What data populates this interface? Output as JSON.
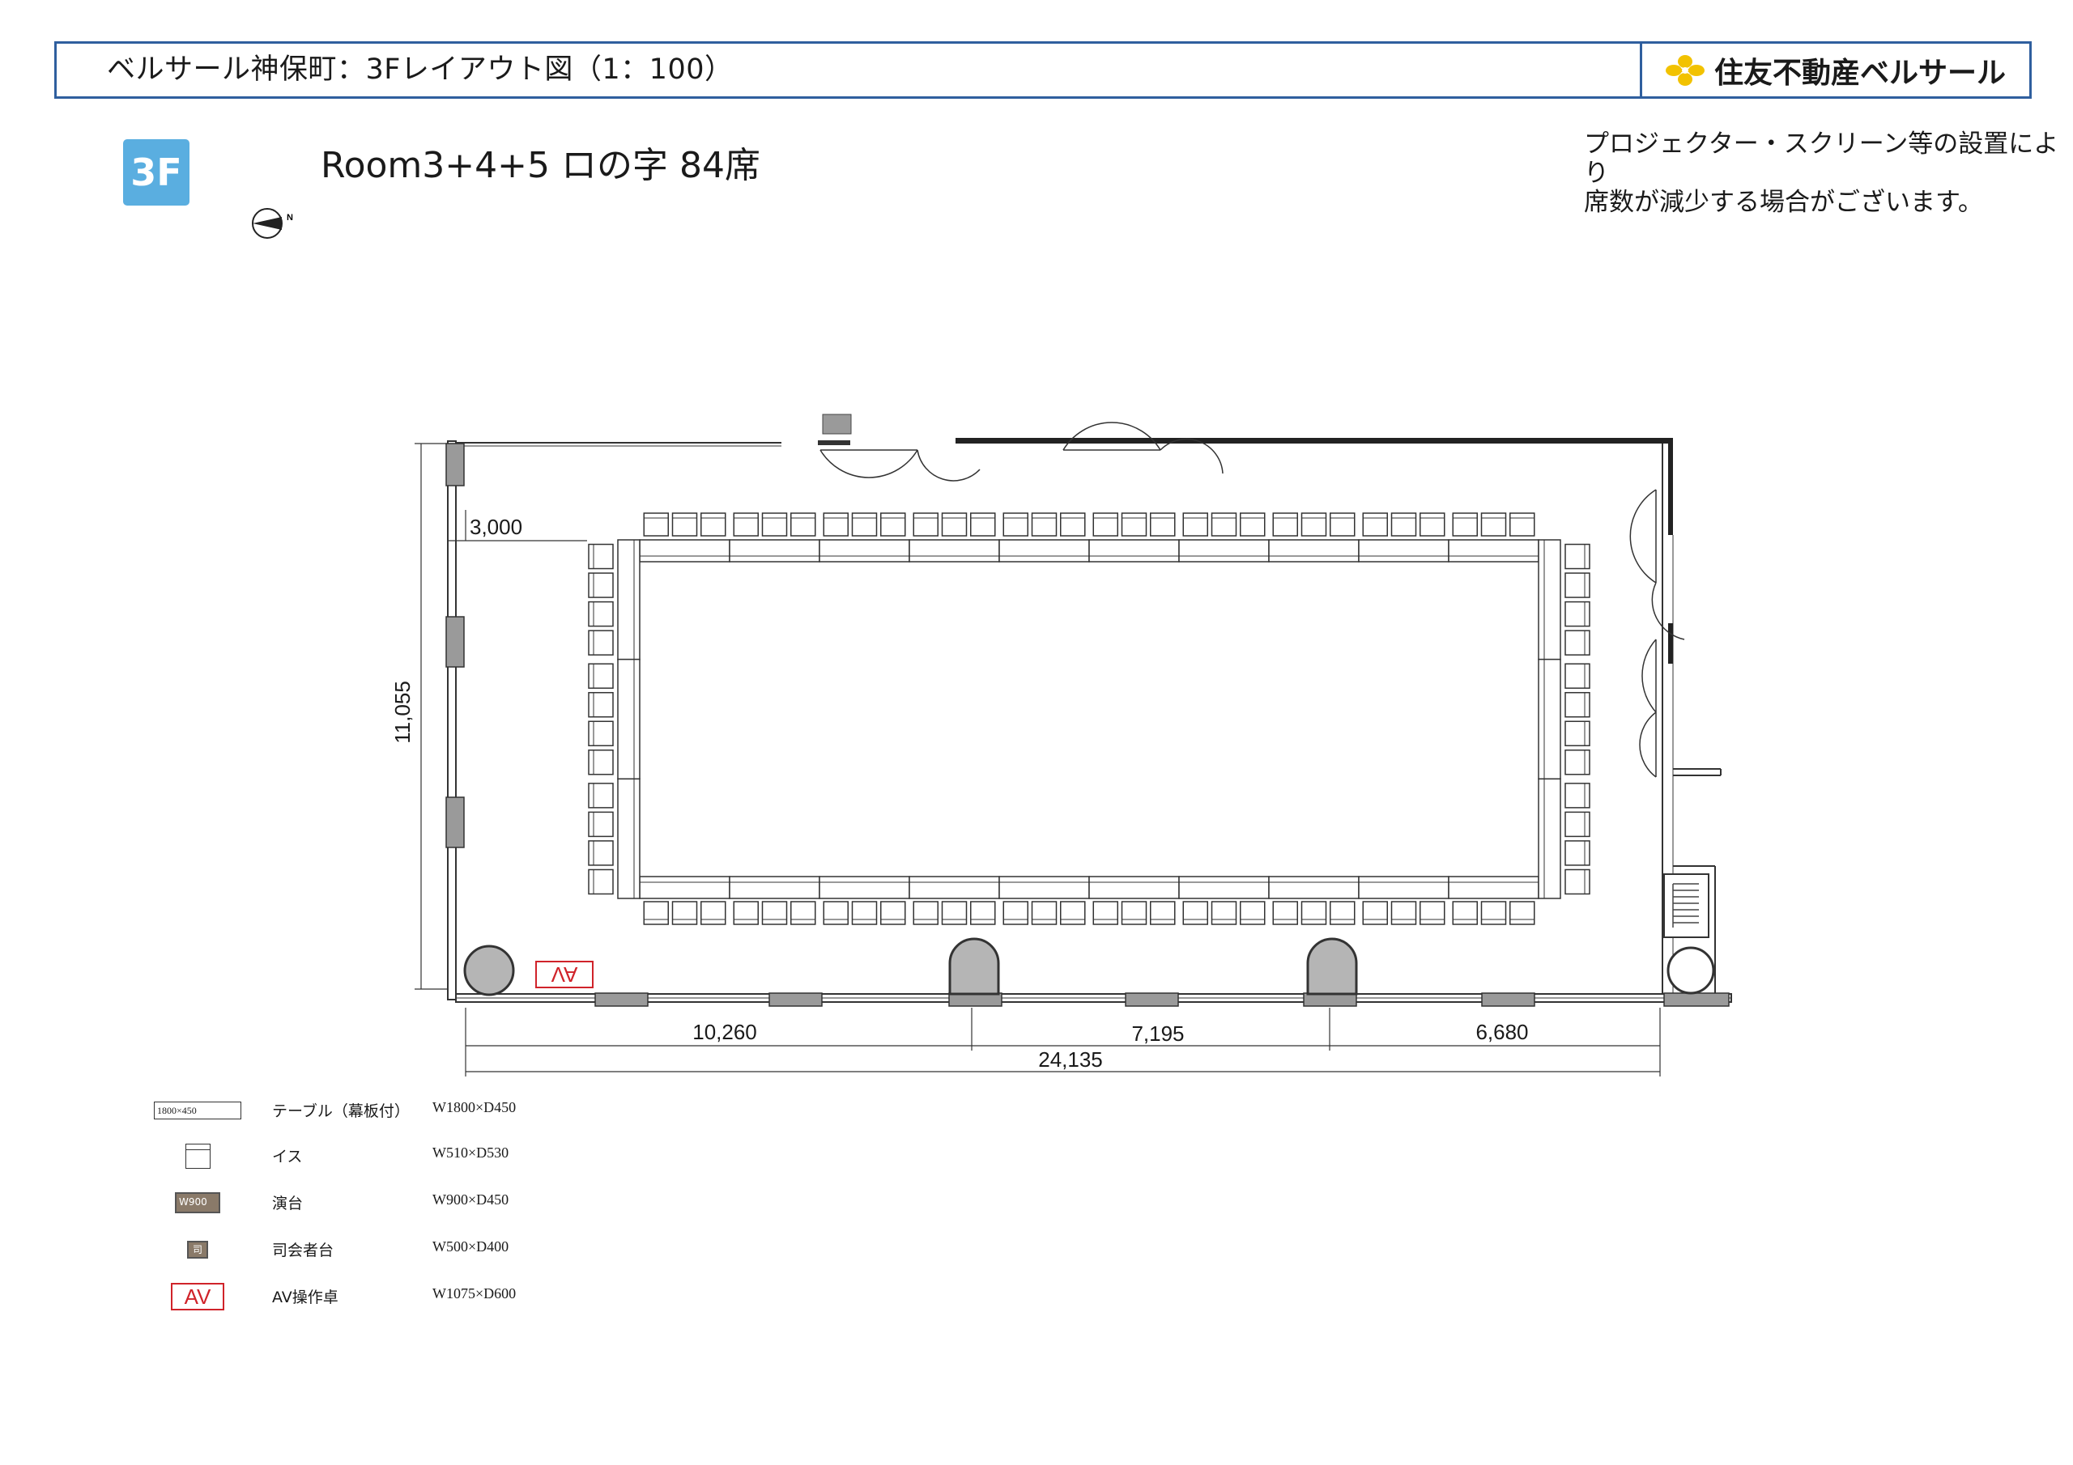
{
  "header": {
    "title": "ベルサール神保町：3Fレイアウト図（1：100）",
    "brand": "住友不動産ベルサール",
    "brand_color": "#f2c200",
    "border_color": "#2f5f9e"
  },
  "floor_badge": {
    "label": "3F",
    "color": "#5aaee0"
  },
  "room_title": "Room3+4+5 ロの字 84席",
  "notice": [
    "プロジェクター・スクリーン等の設置により",
    "席数が減少する場合がございます。"
  ],
  "compass": {
    "label": "N"
  },
  "plan": {
    "dimensions": {
      "left_offset": "3,000",
      "height": "11,055",
      "seg1": "10,260",
      "seg2": "7,195",
      "seg3": "6,680",
      "total": "24,135"
    },
    "av_label": "AV",
    "seat_count": 84,
    "tables_per_long_side": 10,
    "chairs_per_table": 3,
    "tables_per_short_side": 3,
    "chairs_per_short_table": 4
  },
  "legend": [
    {
      "symbol": "table",
      "symbol_text": "1800×450",
      "name": "テーブル（幕板付）",
      "size": "W1800×D450"
    },
    {
      "symbol": "chair",
      "symbol_text": "",
      "name": "イス",
      "size": "W510×D530"
    },
    {
      "symbol": "podium",
      "symbol_text": "W900",
      "name": "演台",
      "size": "W900×D450"
    },
    {
      "symbol": "mc",
      "symbol_text": "司",
      "name": "司会者台",
      "size": "W500×D400"
    },
    {
      "symbol": "av",
      "symbol_text": "AV",
      "name": "AV操作卓",
      "size": "W1075×D600"
    }
  ]
}
